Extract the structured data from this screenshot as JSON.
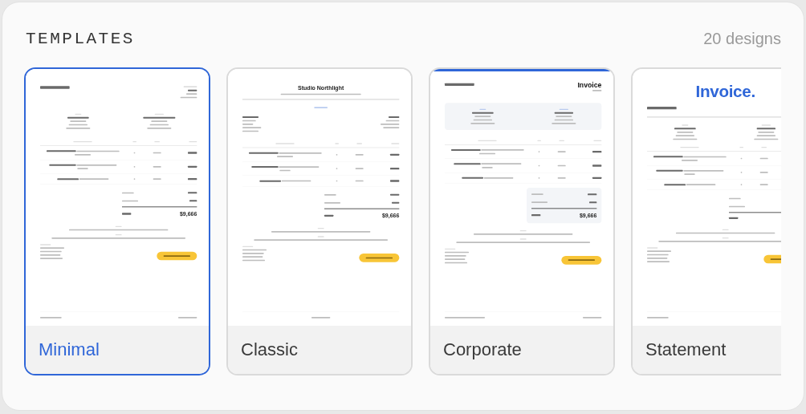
{
  "header": {
    "title": "TEMPLATES",
    "count": "20 designs"
  },
  "templates": [
    {
      "name": "Minimal",
      "selected": true,
      "kind": "minimal",
      "preview": {
        "total": "$9,666"
      }
    },
    {
      "name": "Classic",
      "selected": false,
      "kind": "classic",
      "preview": {
        "studio": "Studio Northlight",
        "total": "$9,666"
      }
    },
    {
      "name": "Corporate",
      "selected": false,
      "kind": "corporate",
      "preview": {
        "heading": "Invoice",
        "total": "$9,666"
      }
    },
    {
      "name": "Statement",
      "selected": false,
      "kind": "statement",
      "preview": {
        "heading": "Invoice."
      }
    }
  ]
}
